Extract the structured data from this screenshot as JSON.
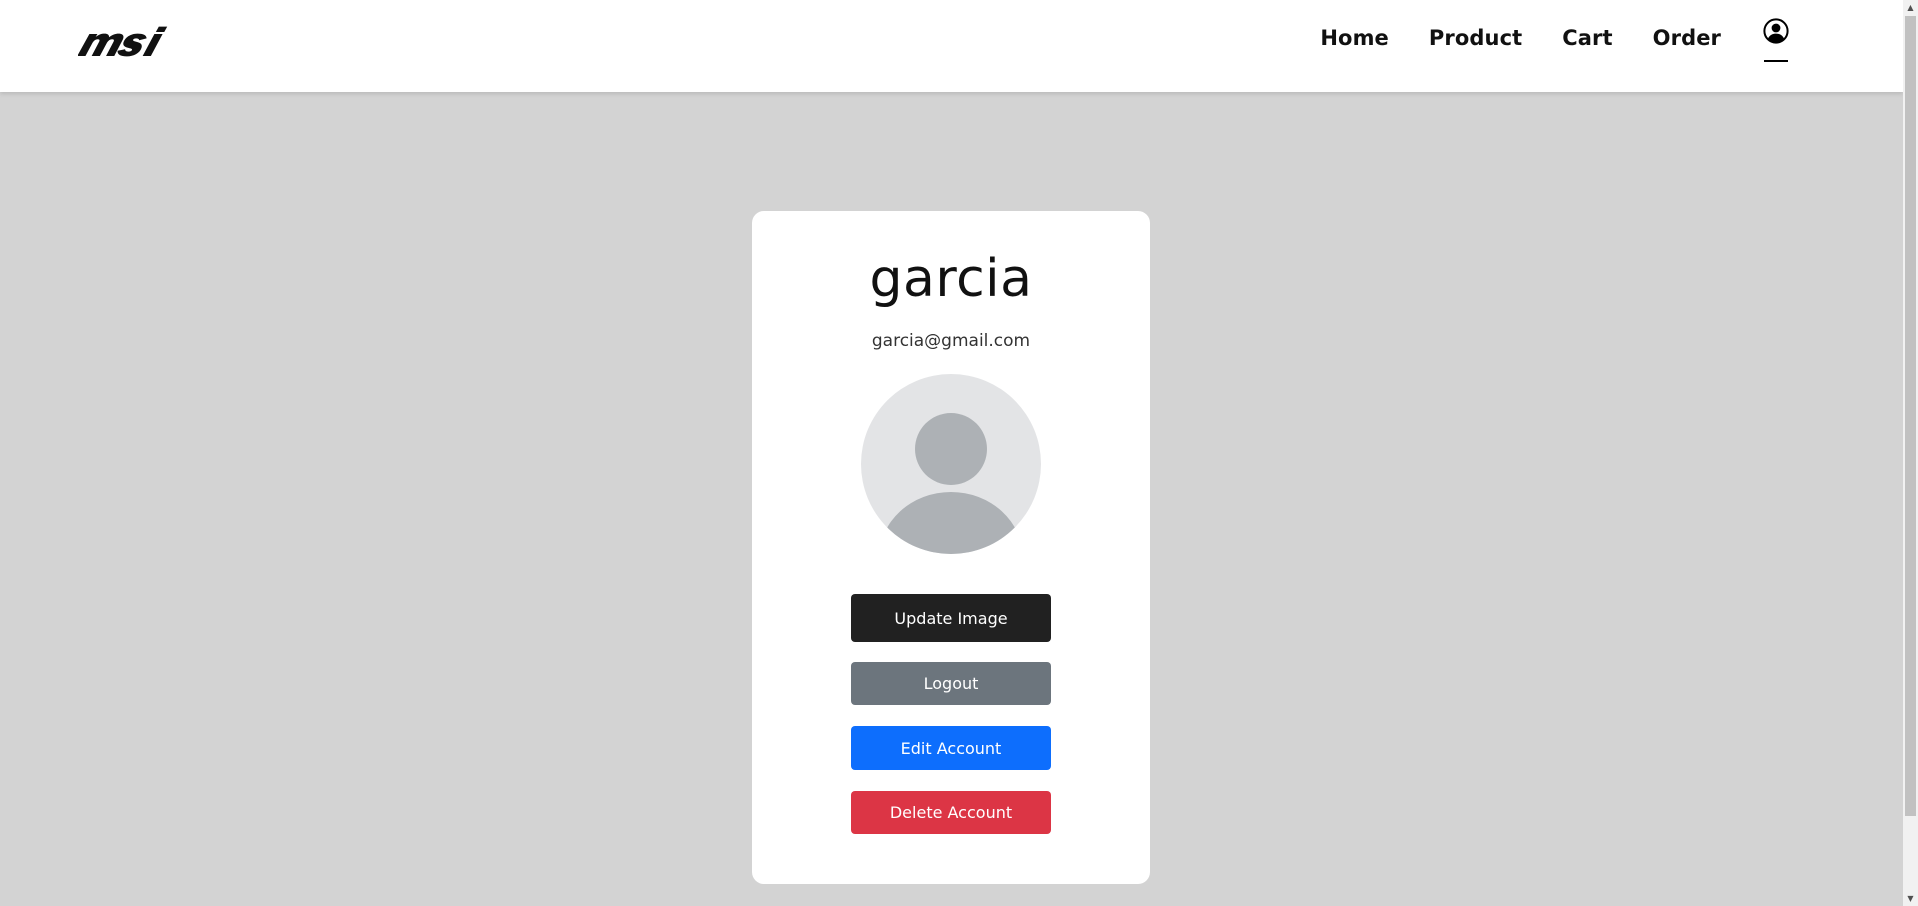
{
  "brand": {
    "logo_text": "msi"
  },
  "nav": {
    "items": [
      {
        "label": "Home"
      },
      {
        "label": "Product"
      },
      {
        "label": "Cart"
      },
      {
        "label": "Order"
      }
    ],
    "profile_icon": "user-circle-icon"
  },
  "profile": {
    "username": "garcia",
    "email": "garcia@gmail.com",
    "avatar_icon": "default-avatar-icon"
  },
  "actions": {
    "update_image": "Update Image",
    "logout": "Logout",
    "edit_account": "Edit Account",
    "delete_account": "Delete Account"
  },
  "colors": {
    "page_bg": "#d3d3d3",
    "dark": "#212121",
    "secondary": "#6c757d",
    "primary": "#0d6efd",
    "danger": "#dc3545"
  }
}
